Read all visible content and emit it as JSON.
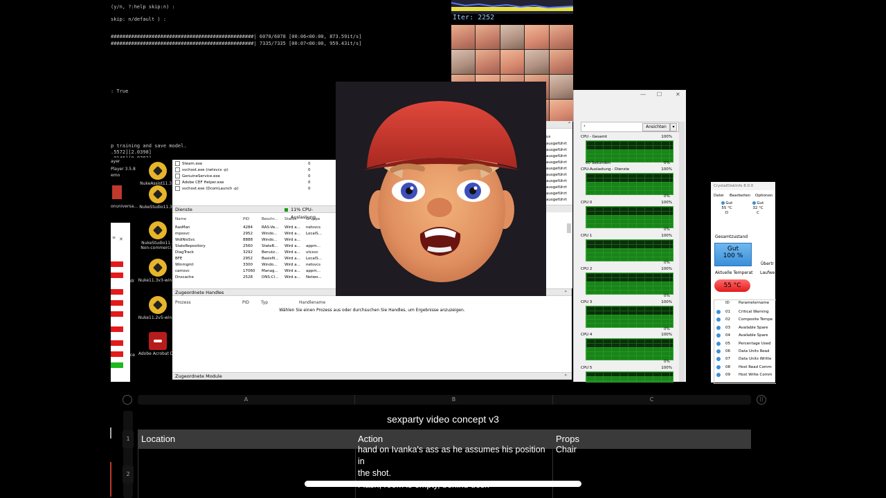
{
  "terminal": {
    "lines": [
      "(y/n, ?:help skip:n) :",
      "skip: n/default ) :",
      "#################################################| 6078/6078 [00:06<00:00, 873.59it/s]",
      "#################################################| 7335/7335 [00:07<00:00, 959.43it/s]",
      ": True",
      "p training and save model.",
      ".5572][2.0398]",
      ".0146][0.8783]"
    ]
  },
  "faces": {
    "iter_label": "Iter: 2252"
  },
  "desktop": {
    "icons": [
      {
        "label": "NukeAssist11.3...",
        "type": "nuke"
      },
      {
        "label": "NukeStudio11.3...",
        "type": "nuke"
      },
      {
        "label": "NukeStudio11.3 Non-commerci...",
        "type": "nuke"
      },
      {
        "label": "Nuke11.3v3-win-...",
        "type": "nuke"
      },
      {
        "label": "Nuke11.2v5-win-...",
        "type": "nuke"
      },
      {
        "label": "Adobe Acrobat D...",
        "type": "acrobat"
      }
    ],
    "left_labels": [
      "ayer",
      "Player 3.5.8",
      "emo",
      "onuniversa...",
      "dr",
      "ce"
    ]
  },
  "taskmgr": {
    "process_rows": [
      {
        "name": "Steam.exe",
        "val": "0"
      },
      {
        "name": "svchost.exe (netsvcs -p)",
        "val": "0"
      },
      {
        "name": "GenuineService.exe",
        "val": "0"
      },
      {
        "name": "Adobe CEF Helper.exe",
        "val": "0"
      },
      {
        "name": "svchost.exe (DcomLaunch -p)",
        "val": "0"
      }
    ],
    "services_header": "Dienste",
    "services_cpu": "11% CPU-Auslastung",
    "services_cols": [
      "Name",
      "PID",
      "Beschr...",
      "Status",
      "Gruppe"
    ],
    "services_rows": [
      [
        "RasMan",
        "4284",
        "RAS-Ve...",
        "Wird a...",
        "netsvcs"
      ],
      [
        "mpssvc",
        "2952",
        "Windo...",
        "Wird a...",
        "LocalS..."
      ],
      [
        "WdiNisSvc",
        "8888",
        "Windo...",
        "Wird a...",
        ""
      ],
      [
        "StateRepository",
        "2560",
        "StateR...",
        "Wird a...",
        "appm..."
      ],
      [
        "DiagTrack",
        "3292",
        "Benutz...",
        "Wird a...",
        "utcsvc"
      ],
      [
        "BFE",
        "2952",
        "Basisfil...",
        "Wird a...",
        "LocalS..."
      ],
      [
        "Winmgmt",
        "3300",
        "Windo...",
        "Wird a...",
        "netsvcs"
      ],
      [
        "camsvc",
        "17060",
        "Manag...",
        "Wird a...",
        "appm..."
      ],
      [
        "Dnscache",
        "2528",
        "DNS-Cl...",
        "Wird a...",
        "Netwo..."
      ]
    ],
    "right_status": [
      "us",
      "ausgeführt",
      "ausgeführt",
      "ausgeführt",
      "ausgeführt",
      "ausgeführt",
      "ausgeführt",
      "ausgeführt",
      "ausgeführt",
      "ausgeführt",
      "ausgeführt"
    ],
    "handles_header": "Zugeordnete Handles",
    "handles_cols": [
      "Prozess",
      "PID",
      "Typ",
      "Handlename"
    ],
    "handles_hint": "Wählen Sie einen Prozess aus oder durchsuchen Sie Handles, um Ergebnisse anzuzeigen.",
    "modules_header": "Zugeordnete Module"
  },
  "resmon": {
    "view_button": "Ansichten",
    "graphs": [
      {
        "label": "CPU - Gesamt",
        "max": "100%",
        "footer": "60 Sekunden",
        "min": "0%"
      },
      {
        "label": "CPU-Auslastung - Dienste",
        "max": "100%",
        "footer": "",
        "min": "0%"
      },
      {
        "label": "CPU 0",
        "max": "100%",
        "footer": "",
        "min": "0%"
      },
      {
        "label": "CPU 1",
        "max": "100%",
        "footer": "",
        "min": "0%"
      },
      {
        "label": "CPU 2",
        "max": "100%",
        "footer": "",
        "min": "0%"
      },
      {
        "label": "CPU 3",
        "max": "100%",
        "footer": "",
        "min": "0%"
      },
      {
        "label": "CPU 4",
        "max": "100%",
        "footer": "",
        "min": "0%"
      },
      {
        "label": "CPU 5",
        "max": "100%",
        "footer": "",
        "min": ""
      }
    ]
  },
  "crystal": {
    "title": "CrystalDiskInfo 8.0.0",
    "menu": [
      "Datei",
      "Bearbeiten",
      "Optionen"
    ],
    "drive1": {
      "status": "Gut",
      "temp": "55 °C",
      "letter": "D"
    },
    "drive2": {
      "status": "Gut",
      "temp": "32 °C",
      "letter": "C"
    },
    "health_label": "Gesamtzustand",
    "health_status": "Gut",
    "health_percent": "100 %",
    "temp_label": "Aktuelle Temperat",
    "temp_value": "55 °C",
    "side_labels": [
      "Übertr",
      "Laufwe"
    ],
    "table_cols": [
      "ID",
      "Parametername"
    ],
    "table_rows": [
      [
        "01",
        "Critical Warning"
      ],
      [
        "02",
        "Composite Tempe"
      ],
      [
        "03",
        "Available Spare"
      ],
      [
        "04",
        "Available Spare"
      ],
      [
        "05",
        "Percentage Used"
      ],
      [
        "06",
        "Data Units Read"
      ],
      [
        "07",
        "Data Units Writte"
      ],
      [
        "08",
        "Host Read Comm"
      ],
      [
        "09",
        "Host Write Comm"
      ]
    ]
  },
  "sheet": {
    "col_headers": [
      "A",
      "B",
      "C"
    ],
    "title": "sexparty video concept v3",
    "headers": [
      "Location",
      "Action",
      "Props"
    ],
    "row_numbers": [
      "1",
      "2"
    ],
    "row2_action_lines": [
      "hand on Ivanka's ass as he assumes his position in",
      "the shot.",
      "Flash, room is empty, behind desk"
    ],
    "row2_props": "Chair"
  },
  "colors": {
    "cpu_green": "#28c828",
    "health_blue": "#3a8fd8",
    "temp_red": "#e21b1b",
    "cap_red": "#c8322a"
  }
}
